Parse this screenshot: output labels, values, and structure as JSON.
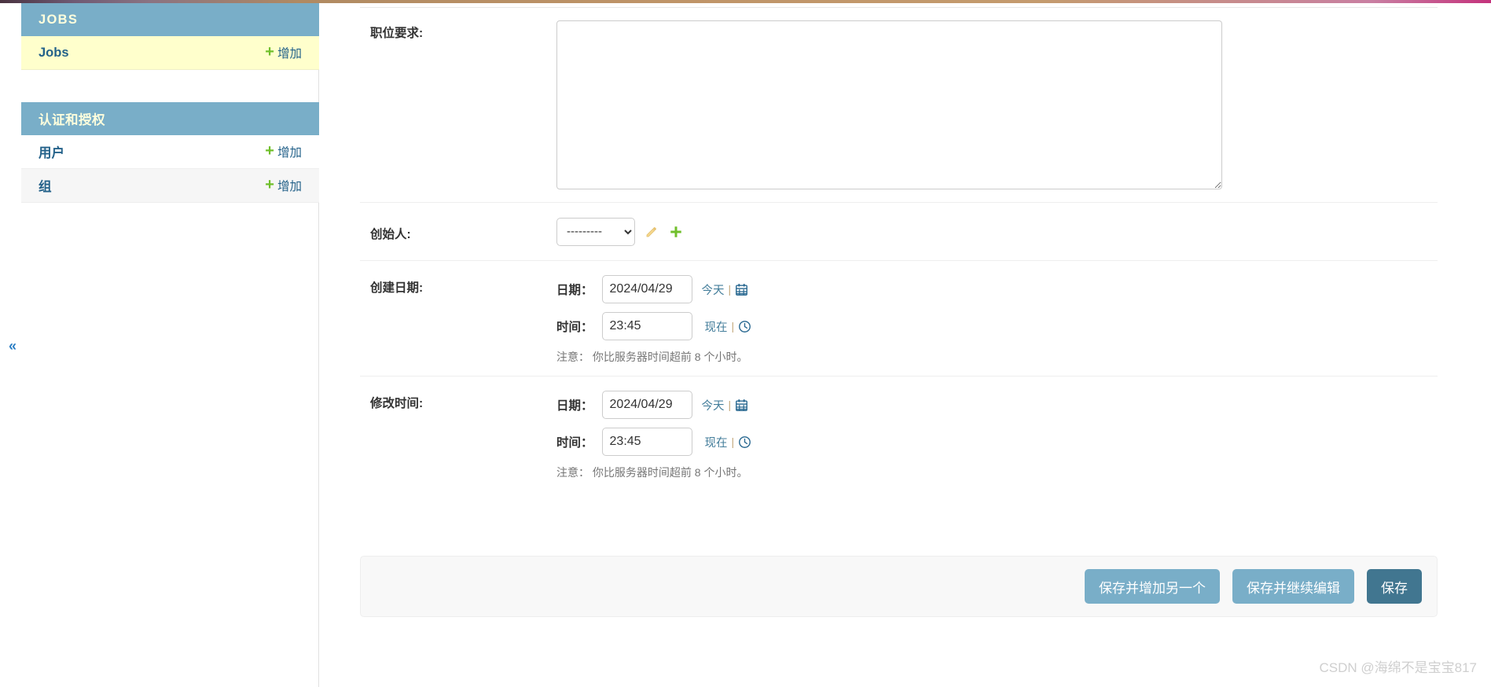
{
  "theme": {
    "accent": "#79aec8",
    "accent_dark": "#417690",
    "link": "#24628a",
    "add_green": "#70bf2b",
    "selected_row_bg": "#ffffcc",
    "header_text": "#ffffdd"
  },
  "sidebar": {
    "toggle_icon": "«",
    "modules": [
      {
        "caption": "JOBS",
        "caption_latin": true,
        "rows": [
          {
            "label": "Jobs",
            "add_label": "增加",
            "current": true,
            "alt": false
          }
        ]
      },
      {
        "caption": "认证和授权",
        "caption_latin": false,
        "rows": [
          {
            "label": "用户",
            "add_label": "增加",
            "current": false,
            "alt": false
          },
          {
            "label": "组",
            "add_label": "增加",
            "current": false,
            "alt": true
          }
        ]
      }
    ]
  },
  "form": {
    "requirement": {
      "label": "职位要求:",
      "value": "",
      "placeholder": ""
    },
    "creator": {
      "label": "创始人:",
      "selected_option": "---------",
      "options": [
        "---------"
      ],
      "edit_title": "修改",
      "add_title": "增加"
    },
    "created_date": {
      "label": "创建日期:",
      "date_label": "日期：",
      "date_value": "2024/04/29",
      "date_shortcut": "今天",
      "date_separator": "|",
      "time_label": "时间：",
      "time_value": "23:45",
      "time_shortcut": "现在",
      "time_separator": "|",
      "timezone_warning": "注意： 你比服务器时间超前 8 个小时。"
    },
    "modified_time": {
      "label": "修改时间:",
      "date_label": "日期：",
      "date_value": "2024/04/29",
      "date_shortcut": "今天",
      "date_separator": "|",
      "time_label": "时间：",
      "time_value": "23:45",
      "time_shortcut": "现在",
      "time_separator": "|",
      "timezone_warning": "注意： 你比服务器时间超前 8 个小时。"
    }
  },
  "submit_row": {
    "save_add_another": "保存并增加另一个",
    "save_continue": "保存并继续编辑",
    "save": "保存"
  },
  "watermark": "CSDN @海绵不是宝宝817"
}
